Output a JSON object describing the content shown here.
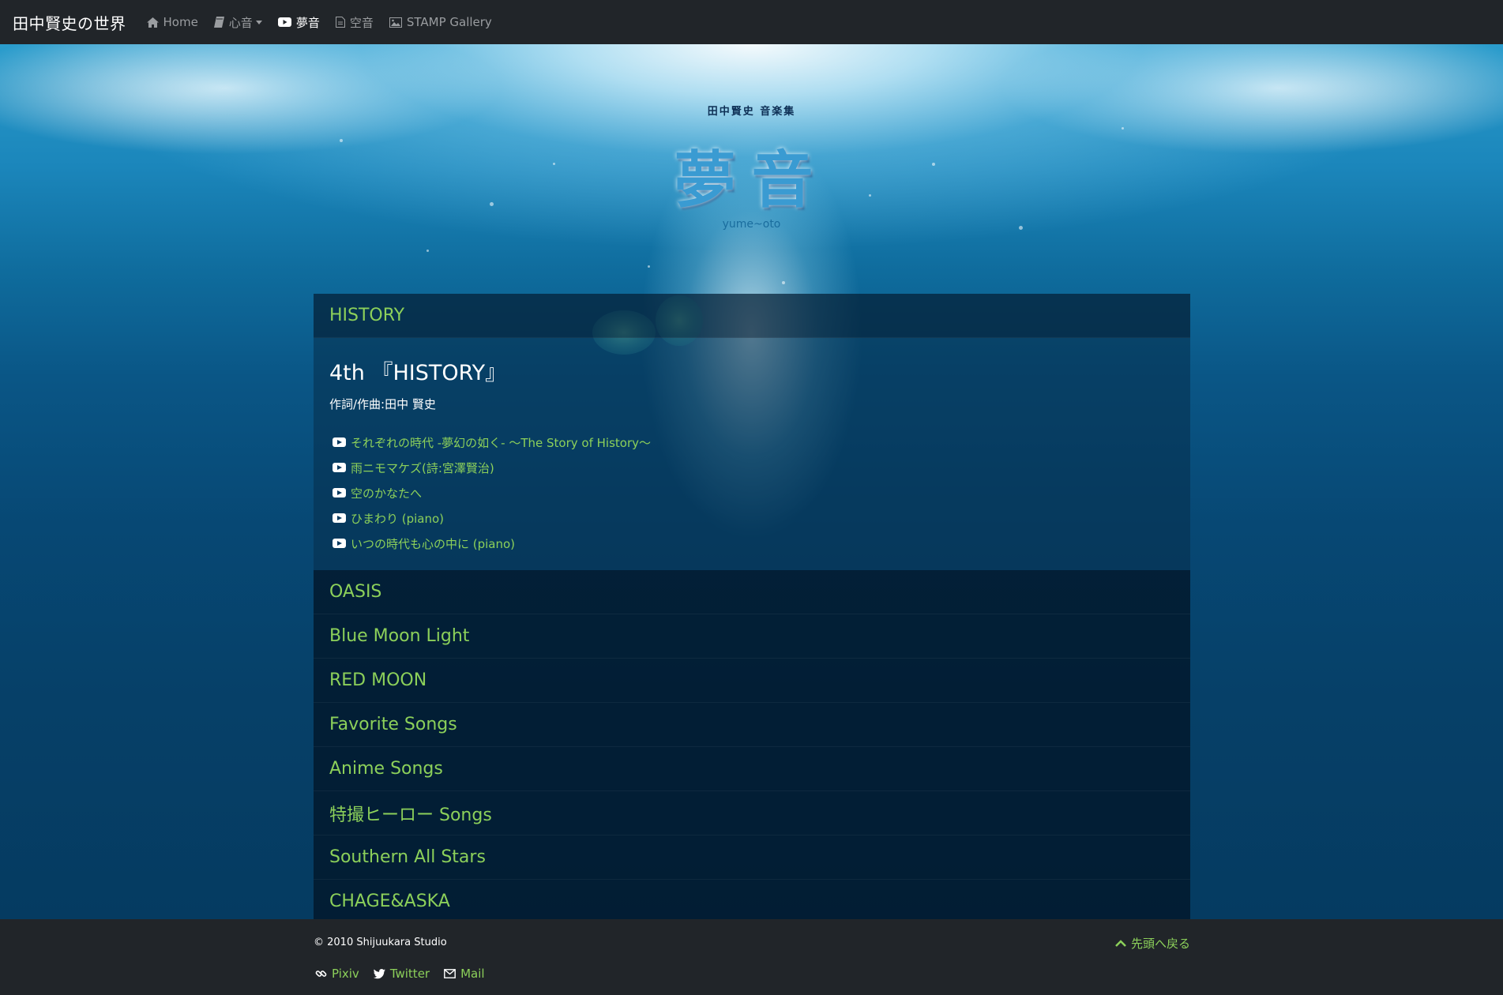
{
  "navbar": {
    "brand": "田中賢史の世界",
    "items": [
      {
        "label": "Home",
        "icon": "home-icon"
      },
      {
        "label": "心音",
        "icon": "book-icon",
        "dropdown": true
      },
      {
        "label": "夢音",
        "icon": "youtube-icon",
        "active": true
      },
      {
        "label": "空音",
        "icon": "document-icon"
      },
      {
        "label": "STAMP Gallery",
        "icon": "image-icon"
      }
    ]
  },
  "hero": {
    "subtitle": "田中賢史 音楽集",
    "title": "夢音",
    "romaji": "yume~oto"
  },
  "sections": [
    {
      "label": "HISTORY",
      "expanded": true
    },
    {
      "label": "OASIS"
    },
    {
      "label": "Blue Moon Light"
    },
    {
      "label": "RED MOON"
    },
    {
      "label": "Favorite Songs"
    },
    {
      "label": "Anime Songs"
    },
    {
      "label": "特撮ヒーロー Songs"
    },
    {
      "label": "Southern All Stars"
    },
    {
      "label": "CHAGE&ASKA"
    }
  ],
  "album": {
    "title": "4th 『HISTORY』",
    "credit": "作詞/作曲:田中 賢史",
    "songs": [
      "それぞれの時代 -夢幻の如く- ～The Story of History～",
      "雨ニモマケズ(詩:宮澤賢治)",
      "空のかなたへ",
      "ひまわり (piano)",
      "いつの時代も心の中に (piano)"
    ]
  },
  "footer": {
    "copyright": "© 2010 Shijuukara Studio",
    "back_to_top": "先頭へ戻る",
    "links": [
      {
        "label": "Pixiv",
        "icon": "link-icon"
      },
      {
        "label": "Twitter",
        "icon": "twitter-icon"
      },
      {
        "label": "Mail",
        "icon": "mail-icon"
      }
    ]
  },
  "colors": {
    "accent": "#8cd05a",
    "navbar": "#212529",
    "ocean": "#0a5686"
  }
}
